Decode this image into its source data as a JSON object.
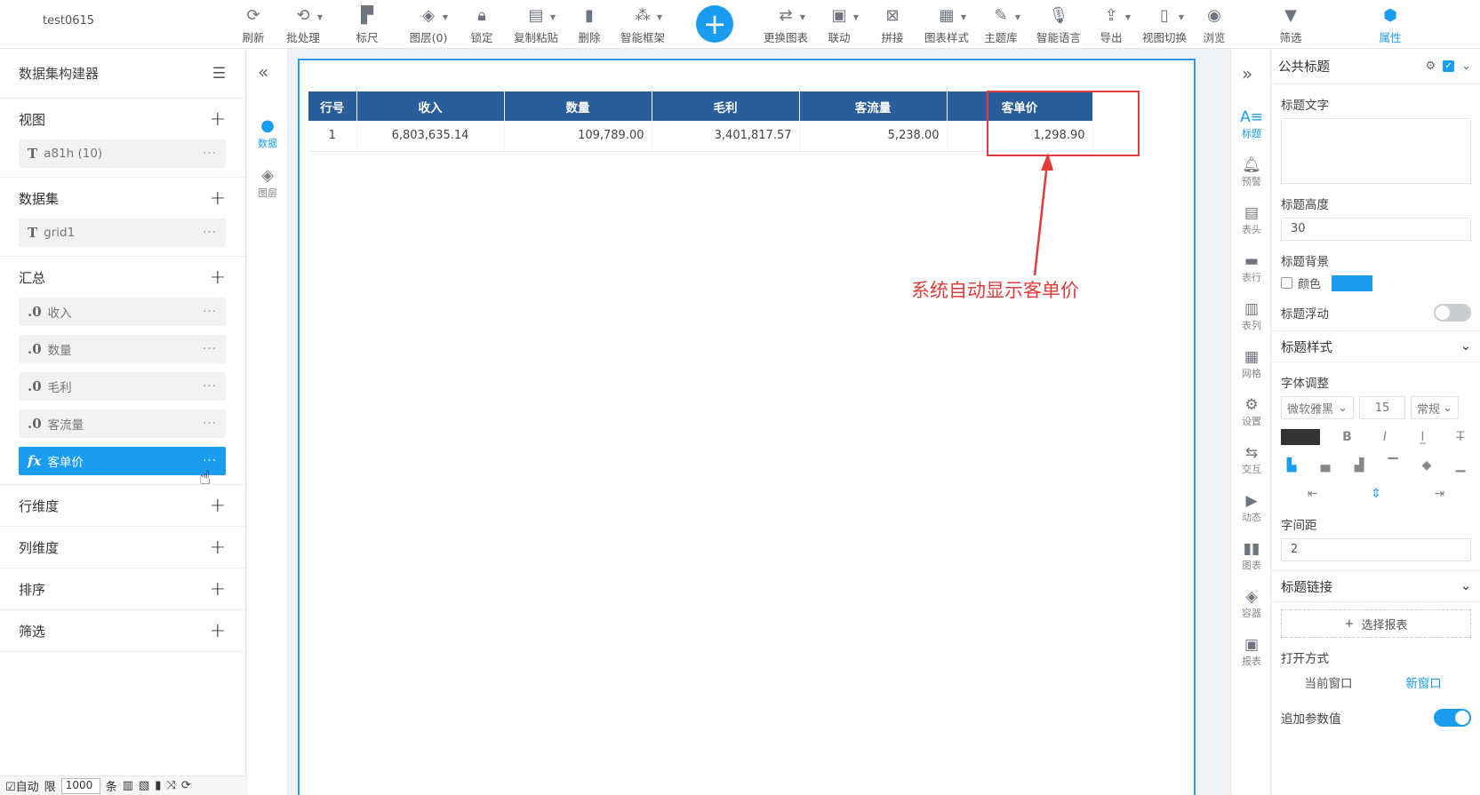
{
  "app": {
    "title": "test0615"
  },
  "toolbar": {
    "items": [
      {
        "label": "刷新",
        "icon": "refresh-icon"
      },
      {
        "label": "批处理",
        "icon": "batch-icon"
      },
      {
        "label": "标尺",
        "icon": "ruler-icon"
      },
      {
        "label": "图层(0)",
        "icon": "layers-icon"
      },
      {
        "label": "锁定",
        "icon": "lock-icon"
      },
      {
        "label": "复制粘贴",
        "icon": "copy-paste-icon"
      },
      {
        "label": "删除",
        "icon": "trash-icon"
      },
      {
        "label": "智能框架",
        "icon": "smart-frame-icon"
      },
      {
        "label": "更换图表",
        "icon": "swap-chart-icon"
      },
      {
        "label": "联动",
        "icon": "link-icon"
      },
      {
        "label": "拼接",
        "icon": "splice-icon"
      },
      {
        "label": "图表样式",
        "icon": "chart-style-icon"
      },
      {
        "label": "主题库",
        "icon": "theme-icon"
      },
      {
        "label": "智能语言",
        "icon": "mic-icon"
      },
      {
        "label": "导出",
        "icon": "export-icon"
      },
      {
        "label": "视图切换",
        "icon": "device-icon"
      },
      {
        "label": "浏览",
        "icon": "eye-icon"
      },
      {
        "label": "筛选",
        "icon": "filter-icon"
      },
      {
        "label": "属性",
        "icon": "hexagon-icon"
      }
    ]
  },
  "left": {
    "title": "数据集构建器",
    "sections": [
      {
        "title": "视图",
        "fields": [
          {
            "type": "T",
            "name": "a81h (10)"
          }
        ]
      },
      {
        "title": "数据集",
        "fields": [
          {
            "type": "T",
            "name": "grid1"
          }
        ]
      },
      {
        "title": "汇总",
        "fields": [
          {
            "type": ".0",
            "name": "收入"
          },
          {
            "type": ".0",
            "name": "数量"
          },
          {
            "type": ".0",
            "name": "毛利"
          },
          {
            "type": ".0",
            "name": "客流量"
          },
          {
            "type": "fx",
            "name": "客单价"
          }
        ]
      },
      {
        "title": "行维度",
        "fields": []
      },
      {
        "title": "列维度",
        "fields": []
      },
      {
        "title": "排序",
        "fields": []
      },
      {
        "title": "筛选",
        "fields": []
      }
    ],
    "footer": {
      "auto": "自动",
      "limit_label": "限",
      "limit_value": "1000",
      "unit": "条"
    }
  },
  "nav": {
    "items": [
      {
        "label": "数据",
        "icon": "data-icon"
      },
      {
        "label": "图层",
        "icon": "layer-icon"
      }
    ]
  },
  "grid": {
    "headers": [
      "行号",
      "收入",
      "数量",
      "毛利",
      "客流量",
      "客单价"
    ],
    "rows": [
      [
        "1",
        "6,803,635.14",
        "109,789.00",
        "3,401,817.57",
        "5,238.00",
        "1,298.90"
      ]
    ]
  },
  "annotation": {
    "text": "系统自动显示客单价",
    "color": "#e23b3b"
  },
  "rnav": {
    "items": [
      {
        "label": "标题",
        "icon": "title-icon"
      },
      {
        "label": "预警",
        "icon": "bell-icon"
      },
      {
        "label": "表头",
        "icon": "table-header-icon"
      },
      {
        "label": "表行",
        "icon": "table-row-icon"
      },
      {
        "label": "表列",
        "icon": "table-column-icon"
      },
      {
        "label": "网格",
        "icon": "grid-icon"
      },
      {
        "label": "设置",
        "icon": "settings-icon"
      },
      {
        "label": "交互",
        "icon": "interaction-icon"
      },
      {
        "label": "动态",
        "icon": "animation-icon"
      },
      {
        "label": "图表",
        "icon": "bar-chart-icon"
      },
      {
        "label": "容器",
        "icon": "container-icon"
      },
      {
        "label": "报表",
        "icon": "report-icon"
      }
    ]
  },
  "props": {
    "title": "公共标题",
    "title_text_label": "标题文字",
    "title_height_label": "标题高度",
    "title_height_value": "30",
    "title_bg_label": "标题背景",
    "color_label": "颜色",
    "float_label": "标题浮动",
    "style_group": "标题样式",
    "font_adjust_label": "字体调整",
    "font_name": "微软雅黑",
    "font_size": "15",
    "font_weight": "常规",
    "letter_spacing_label": "字间距",
    "letter_spacing_value": "2",
    "link_group": "标题链接",
    "select_report": "选择报表",
    "open_mode_label": "打开方式",
    "open_current": "当前窗口",
    "open_new": "新窗口",
    "append_param_label": "追加参数值",
    "accent": "#1a9cf0"
  }
}
